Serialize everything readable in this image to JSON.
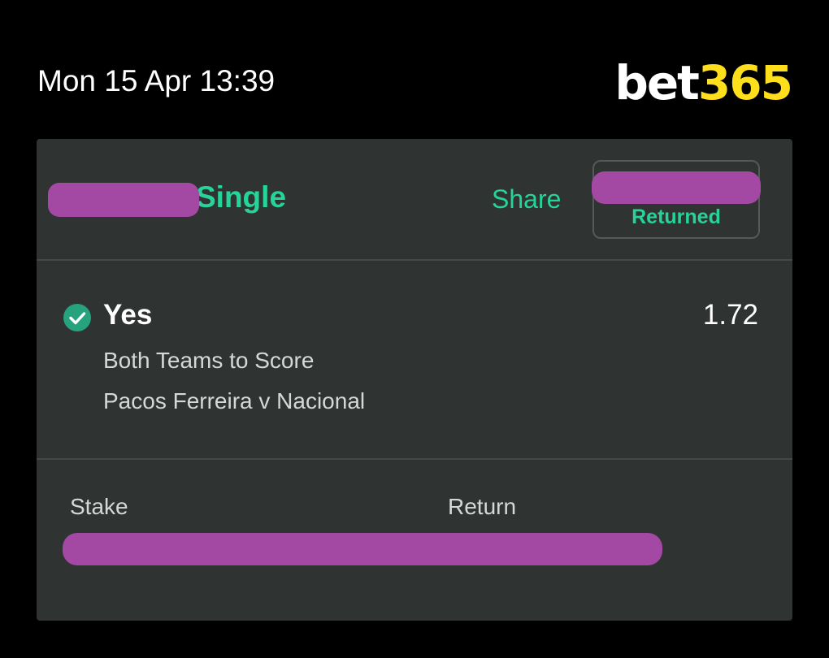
{
  "header": {
    "timestamp": "Mon 15 Apr 13:39",
    "logo_white": "bet",
    "logo_yellow": "365"
  },
  "bet": {
    "type": "Single",
    "share_label": "Share",
    "status": "Returned"
  },
  "selection": {
    "name": "Yes",
    "odds": "1.72",
    "market": "Both Teams to Score",
    "fixture": "Pacos Ferreira v Nacional",
    "result_icon": "check-circle-icon"
  },
  "footer": {
    "stake_label": "Stake",
    "return_label": "Return"
  },
  "colors": {
    "accent_green": "#26d398",
    "brand_yellow": "#ffdf1b",
    "card_bg": "#2f3432",
    "redaction": "#a349a4"
  }
}
